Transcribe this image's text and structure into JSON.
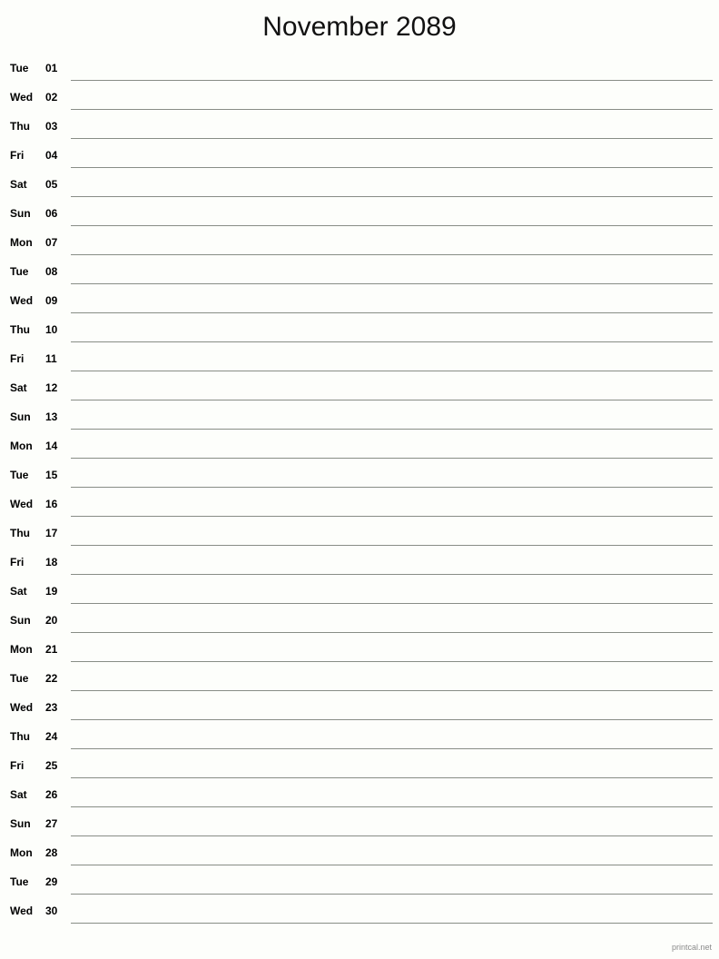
{
  "document": {
    "title": "November 2089",
    "month": "November",
    "year": "2089"
  },
  "footer": {
    "credit": "printcal.net"
  },
  "colors": {
    "background": "#fdfefb",
    "text": "#000000",
    "line": "#888d86",
    "footer_text": "#8a8a8a"
  },
  "days": [
    {
      "weekday": "Tue",
      "date": "01"
    },
    {
      "weekday": "Wed",
      "date": "02"
    },
    {
      "weekday": "Thu",
      "date": "03"
    },
    {
      "weekday": "Fri",
      "date": "04"
    },
    {
      "weekday": "Sat",
      "date": "05"
    },
    {
      "weekday": "Sun",
      "date": "06"
    },
    {
      "weekday": "Mon",
      "date": "07"
    },
    {
      "weekday": "Tue",
      "date": "08"
    },
    {
      "weekday": "Wed",
      "date": "09"
    },
    {
      "weekday": "Thu",
      "date": "10"
    },
    {
      "weekday": "Fri",
      "date": "11"
    },
    {
      "weekday": "Sat",
      "date": "12"
    },
    {
      "weekday": "Sun",
      "date": "13"
    },
    {
      "weekday": "Mon",
      "date": "14"
    },
    {
      "weekday": "Tue",
      "date": "15"
    },
    {
      "weekday": "Wed",
      "date": "16"
    },
    {
      "weekday": "Thu",
      "date": "17"
    },
    {
      "weekday": "Fri",
      "date": "18"
    },
    {
      "weekday": "Sat",
      "date": "19"
    },
    {
      "weekday": "Sun",
      "date": "20"
    },
    {
      "weekday": "Mon",
      "date": "21"
    },
    {
      "weekday": "Tue",
      "date": "22"
    },
    {
      "weekday": "Wed",
      "date": "23"
    },
    {
      "weekday": "Thu",
      "date": "24"
    },
    {
      "weekday": "Fri",
      "date": "25"
    },
    {
      "weekday": "Sat",
      "date": "26"
    },
    {
      "weekday": "Sun",
      "date": "27"
    },
    {
      "weekday": "Mon",
      "date": "28"
    },
    {
      "weekday": "Tue",
      "date": "29"
    },
    {
      "weekday": "Wed",
      "date": "30"
    }
  ]
}
